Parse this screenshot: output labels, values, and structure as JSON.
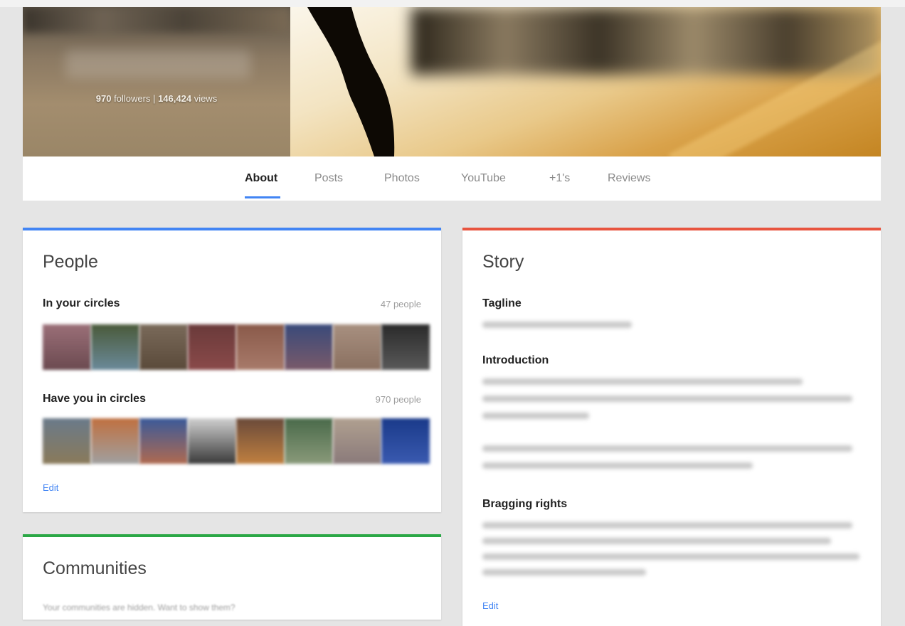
{
  "cover": {
    "followers_count": "970",
    "followers_label": "followers",
    "separator": "|",
    "views_count": "146,424",
    "views_label": "views"
  },
  "tabs": [
    {
      "label": "About",
      "active": true
    },
    {
      "label": "Posts",
      "active": false
    },
    {
      "label": "Photos",
      "active": false
    },
    {
      "label": "YouTube",
      "active": false
    },
    {
      "label": "+1's",
      "active": false
    },
    {
      "label": "Reviews",
      "active": false
    }
  ],
  "people": {
    "title": "People",
    "in_circles": {
      "label": "In your circles",
      "count": "47 people"
    },
    "have_you": {
      "label": "Have you in circles",
      "count": "970 people"
    },
    "edit": "Edit"
  },
  "communities": {
    "title": "Communities",
    "note": "Your communities are hidden. Want to show them?"
  },
  "story": {
    "title": "Story",
    "tagline_label": "Tagline",
    "introduction_label": "Introduction",
    "bragging_label": "Bragging rights",
    "edit": "Edit"
  },
  "colors": {
    "people_accent": "#4285f4",
    "communities_accent": "#2aa745",
    "story_accent": "#e8543f",
    "link": "#4285f4"
  }
}
